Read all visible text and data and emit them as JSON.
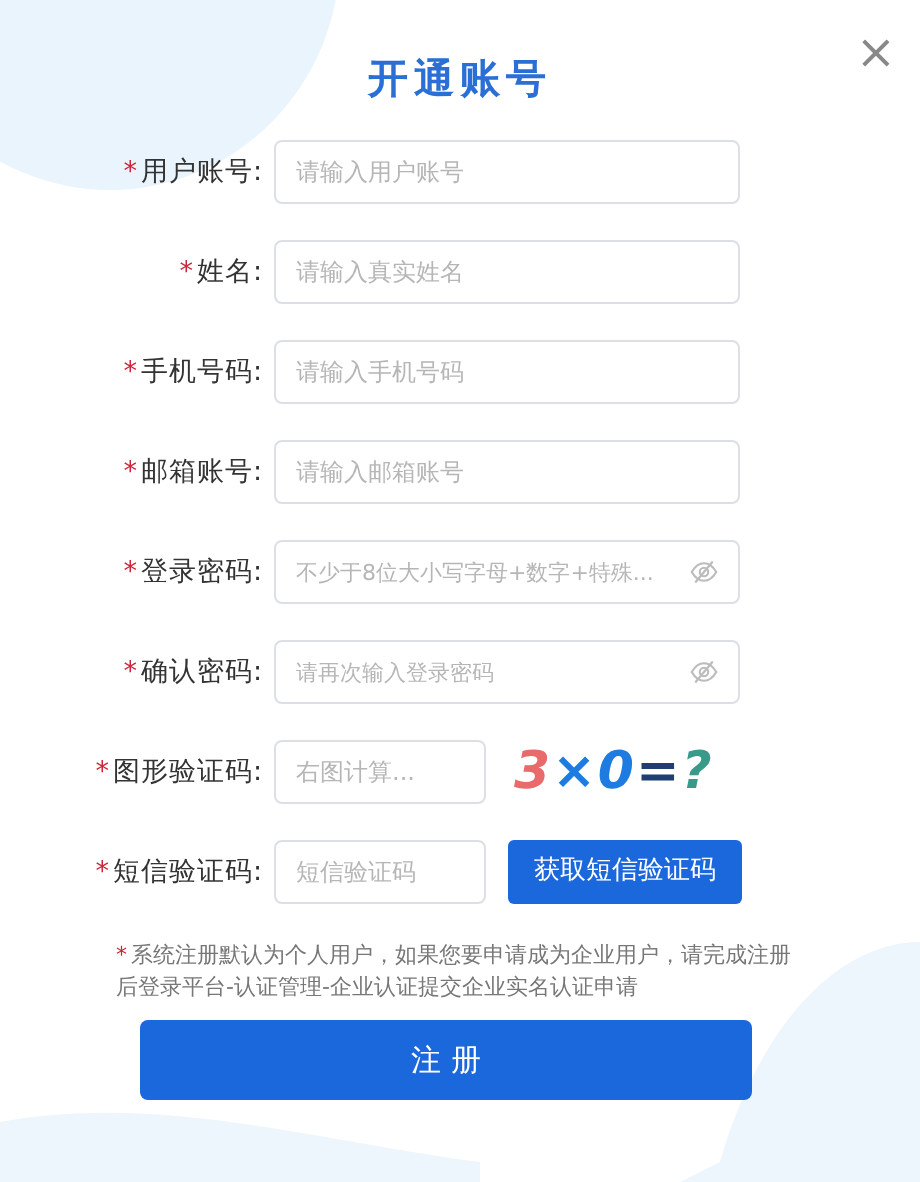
{
  "dialog": {
    "title": "开通账号",
    "close": "×"
  },
  "fields": [
    {
      "kind": "text",
      "required": true,
      "label": "用户账号:",
      "placeholder": "请输入用户账号"
    },
    {
      "kind": "text",
      "required": true,
      "label": "姓名:",
      "placeholder": "请输入真实姓名"
    },
    {
      "kind": "text",
      "required": true,
      "label": "手机号码:",
      "placeholder": "请输入手机号码"
    },
    {
      "kind": "text",
      "required": true,
      "label": "邮箱账号:",
      "placeholder": "请输入邮箱账号"
    },
    {
      "kind": "password",
      "required": true,
      "label": "登录密码:",
      "placeholder": "不少于8位大小写字母+数字+特殊..."
    },
    {
      "kind": "password",
      "required": true,
      "label": "确认密码:",
      "placeholder": "请再次输入登录密码"
    },
    {
      "kind": "captcha",
      "required": true,
      "label": "图形验证码:",
      "placeholder": "右图计算...",
      "captcha": [
        {
          "char": "3",
          "color": "#e86a6a"
        },
        {
          "char": "×",
          "color": "#1e7be0"
        },
        {
          "char": "0",
          "color": "#1e7be0"
        },
        {
          "char": "=",
          "color": "#1f3f73"
        },
        {
          "char": "?",
          "color": "#3a9a8a"
        }
      ]
    },
    {
      "kind": "sms",
      "required": true,
      "label": "短信验证码:",
      "placeholder": "短信验证码",
      "button": "获取短信验证码"
    }
  ],
  "note": {
    "mark": "*",
    "text": "系统注册默认为个人用户，如果您要申请成为企业用户，请完成注册后登录平台-认证管理-企业认证提交企业实名认证申请"
  },
  "submit": "注 册"
}
